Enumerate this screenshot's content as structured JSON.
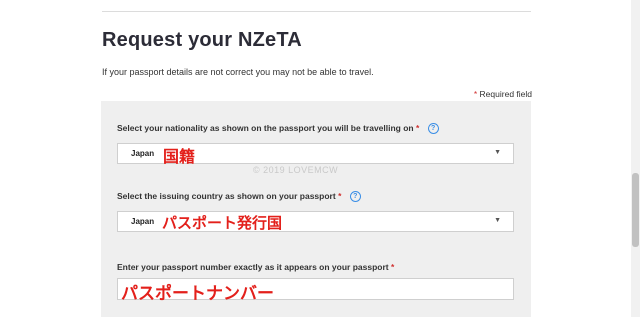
{
  "page": {
    "title": "Request your NZeTA",
    "intro": "If your passport details are not correct you may not be able to travel.",
    "required_note": "Required field"
  },
  "form": {
    "nationality": {
      "label": "Select your nationality as shown on the passport you will be travelling on",
      "value": "Japan",
      "annotation": "国籍"
    },
    "issuing_country": {
      "label": "Select the issuing country as shown on your passport",
      "value": "Japan",
      "annotation": "パスポート発行国"
    },
    "passport_number": {
      "label": "Enter your passport number exactly as it appears on your passport",
      "value": "",
      "annotation": "パスポートナンバー"
    }
  },
  "watermark": "© 2019 LOVEMCW",
  "symbols": {
    "required_star": "*",
    "help": "?",
    "caret": "▼"
  },
  "colors": {
    "required": "#d0302f",
    "help": "#3a8ee6",
    "annotation": "#e3201b"
  }
}
